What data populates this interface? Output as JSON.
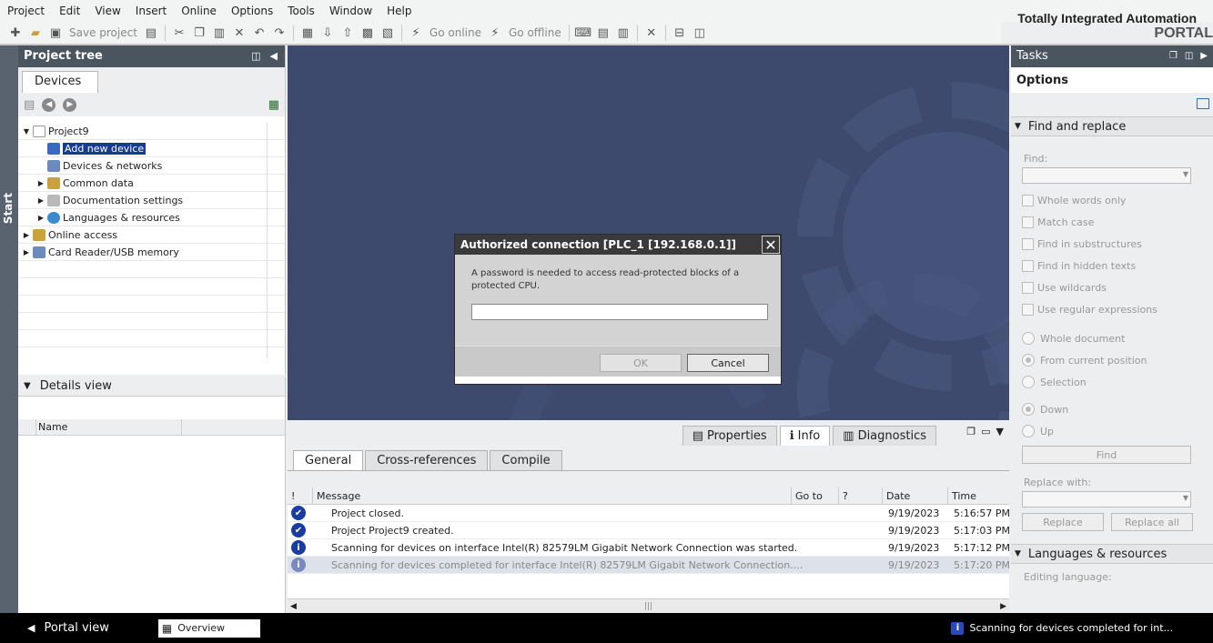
{
  "menu": [
    "Project",
    "Edit",
    "View",
    "Insert",
    "Online",
    "Options",
    "Tools",
    "Window",
    "Help"
  ],
  "brand": {
    "line1": "Totally Integrated Automation",
    "line2": "PORTAL"
  },
  "toolbar": {
    "save_label": "Save project",
    "go_online": "Go online",
    "go_offline": "Go offline"
  },
  "project_tree": {
    "title": "Project tree",
    "tab": "Devices",
    "items": [
      {
        "label": "Project9"
      },
      {
        "label": "Add new device"
      },
      {
        "label": "Devices & networks"
      },
      {
        "label": "Common data"
      },
      {
        "label": "Documentation settings"
      },
      {
        "label": "Languages & resources"
      },
      {
        "label": "Online access"
      },
      {
        "label": "Card Reader/USB memory"
      }
    ]
  },
  "details": {
    "title": "Details view",
    "col_name": "Name"
  },
  "side_tab": "Start",
  "dialog": {
    "title": "Authorized connection [PLC_1 [192.168.0.1]]",
    "message": "A password is needed to access read-protected blocks of a protected CPU.",
    "password_value": "",
    "ok": "OK",
    "cancel": "Cancel"
  },
  "inspector": {
    "tabs": [
      "Properties",
      "Info",
      "Diagnostics"
    ],
    "subtabs": [
      "General",
      "Cross-references",
      "Compile"
    ],
    "columns": {
      "flag": "!",
      "message": "Message",
      "goto": "Go to",
      "q": "?",
      "date": "Date",
      "time": "Time"
    },
    "rows": [
      {
        "message": "Project closed.",
        "date": "9/19/2023",
        "time": "5:16:57 PM"
      },
      {
        "message": "Project Project9 created.",
        "date": "9/19/2023",
        "time": "5:17:03 PM"
      },
      {
        "message": "Scanning for devices on interface Intel(R) 82579LM Gigabit Network Connection was started.",
        "date": "9/19/2023",
        "time": "5:17:12 PM"
      },
      {
        "message": "Scanning for devices completed for interface Intel(R) 82579LM Gigabit Network Connection....",
        "date": "9/19/2023",
        "time": "5:17:20 PM"
      }
    ]
  },
  "tasks": {
    "title": "Tasks",
    "options": "Options",
    "find_replace": "Find and replace",
    "find_label": "Find:",
    "checks": [
      "Whole words only",
      "Match case",
      "Find in substructures",
      "Find in hidden texts",
      "Use wildcards",
      "Use regular expressions"
    ],
    "radios1": [
      "Whole document",
      "From current position",
      "Selection"
    ],
    "radios2": [
      "Down",
      "Up"
    ],
    "find_btn": "Find",
    "replace_label": "Replace with:",
    "replace_btn": "Replace",
    "replace_all_btn": "Replace all",
    "lang_res": "Languages & resources",
    "editing_lang": "Editing language:"
  },
  "statusbar": {
    "portal_view": "Portal view",
    "overview": "Overview",
    "status_msg": "Scanning for devices completed for int..."
  }
}
